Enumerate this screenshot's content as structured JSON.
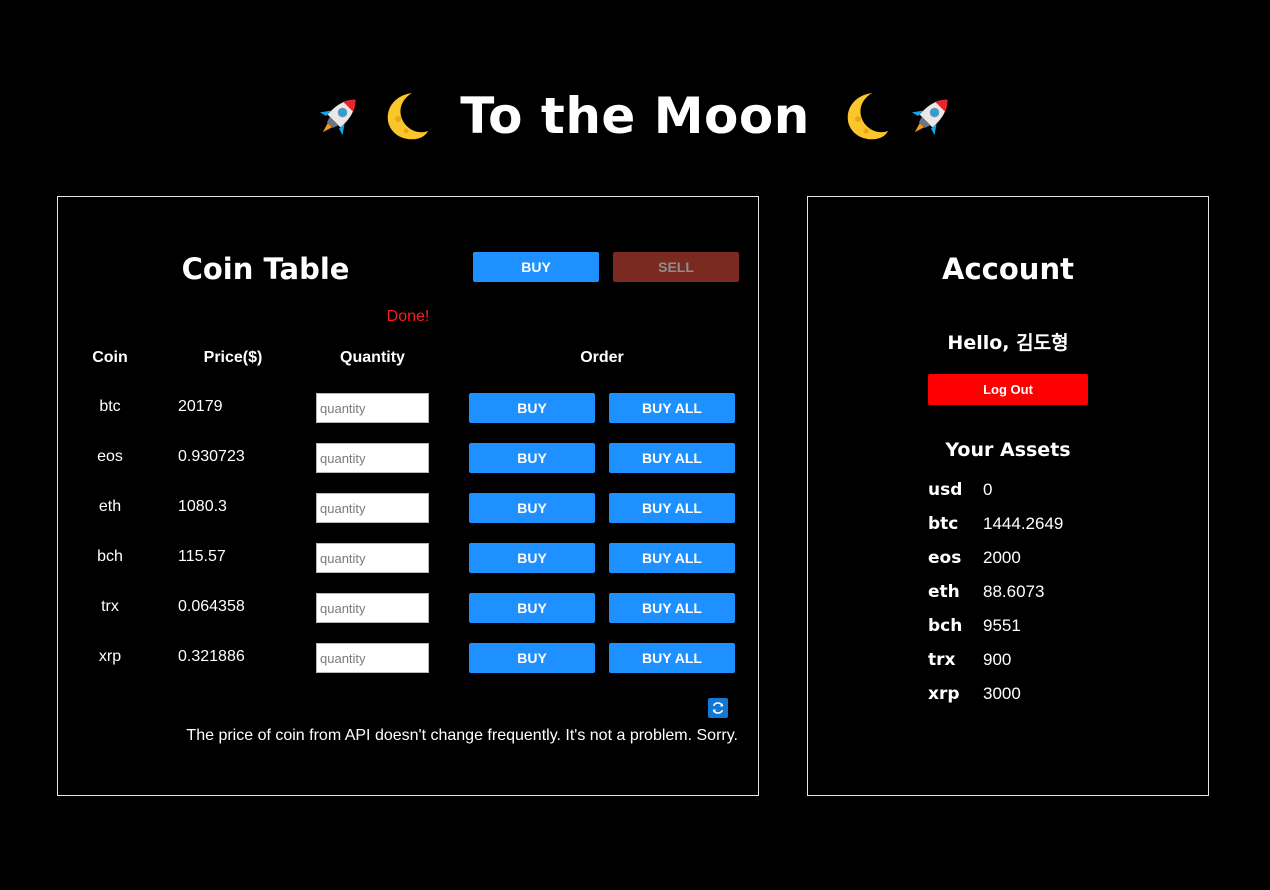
{
  "header": {
    "title": "To the Moon",
    "decor_icons": [
      "rocket-icon",
      "crescent-moon-icon",
      "crescent-moon-icon",
      "rocket-icon"
    ]
  },
  "coin_table": {
    "title": "Coin Table",
    "mode_buy_label": "BUY",
    "mode_sell_label": "SELL",
    "status": "Done!",
    "columns": {
      "coin": "Coin",
      "price": "Price($)",
      "quantity": "Quantity",
      "order": "Order"
    },
    "quantity_placeholder": "quantity",
    "buy_label": "BUY",
    "buy_all_label": "BUY ALL",
    "rows": [
      {
        "coin": "btc",
        "price": "20179"
      },
      {
        "coin": "eos",
        "price": "0.930723"
      },
      {
        "coin": "eth",
        "price": "1080.3"
      },
      {
        "coin": "bch",
        "price": "115.57"
      },
      {
        "coin": "trx",
        "price": "0.064358"
      },
      {
        "coin": "xrp",
        "price": "0.321886"
      }
    ],
    "refresh_icon": "refresh-icon",
    "note": "The price of coin from API doesn't change frequently. It's not a problem. Sorry."
  },
  "account": {
    "title": "Account",
    "greeting": "Hello, 김도형",
    "logout_label": "Log Out",
    "assets_title": "Your Assets",
    "assets": [
      {
        "coin": "usd",
        "amount": "0"
      },
      {
        "coin": "btc",
        "amount": "1444.2649"
      },
      {
        "coin": "eos",
        "amount": "2000"
      },
      {
        "coin": "eth",
        "amount": "88.6073"
      },
      {
        "coin": "bch",
        "amount": "9551"
      },
      {
        "coin": "trx",
        "amount": "900"
      },
      {
        "coin": "xrp",
        "amount": "3000"
      }
    ]
  },
  "colors": {
    "background": "#000000",
    "accent_blue": "#1e90ff",
    "sell_disabled": "#7a2a20",
    "logout_red": "#ff0000",
    "status_red": "#ff1a1a"
  }
}
